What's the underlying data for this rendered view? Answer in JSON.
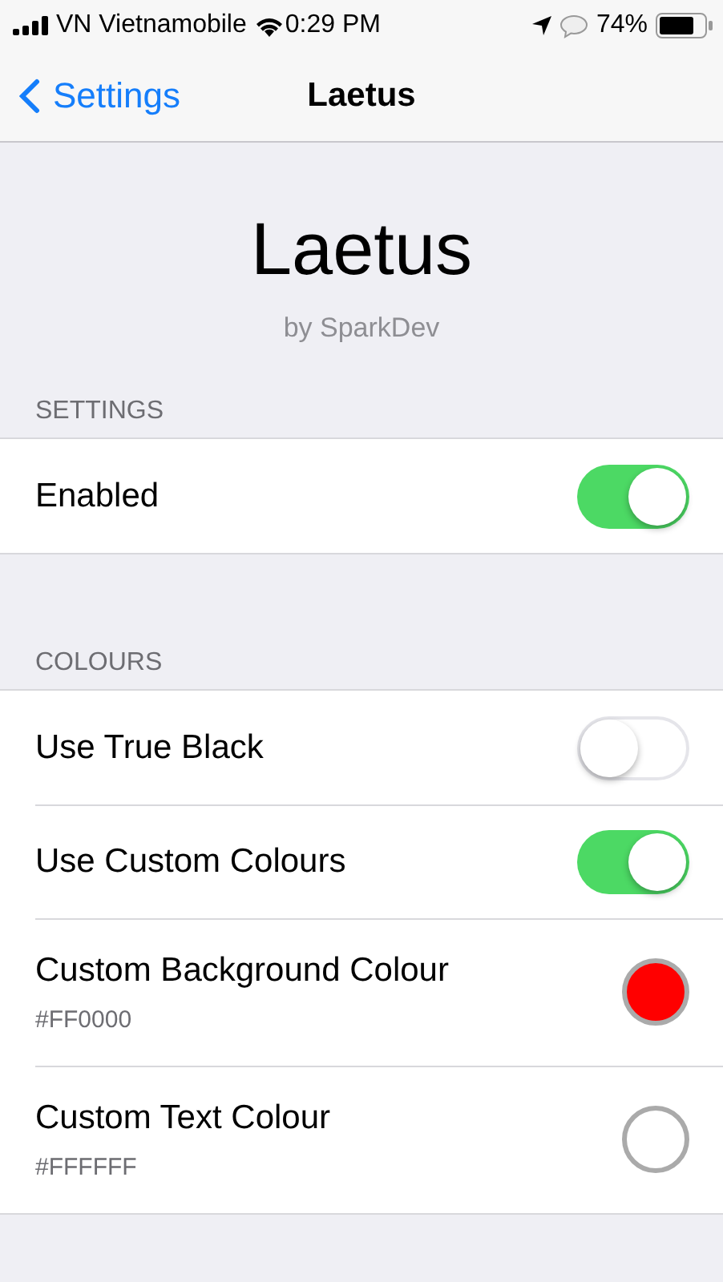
{
  "status_bar": {
    "carrier": "VN Vietnamobile",
    "time": "0:29 PM",
    "battery": "74%"
  },
  "nav": {
    "back": "Settings",
    "title": "Laetus"
  },
  "header": {
    "title": "Laetus",
    "subtitle": "by SparkDev"
  },
  "sections": [
    {
      "title": "SETTINGS",
      "rows": [
        {
          "kind": "toggle",
          "label": "Enabled",
          "on": true
        }
      ]
    },
    {
      "title": "COLOURS",
      "rows": [
        {
          "kind": "toggle",
          "label": "Use True Black",
          "on": false
        },
        {
          "kind": "toggle",
          "label": "Use Custom Colours",
          "on": true
        },
        {
          "kind": "color",
          "label": "Custom Background Colour",
          "value": "#FF0000",
          "color": "#ff0000"
        },
        {
          "kind": "color",
          "label": "Custom Text Colour",
          "value": "#FFFFFF",
          "color": "#ffffff"
        }
      ]
    }
  ]
}
